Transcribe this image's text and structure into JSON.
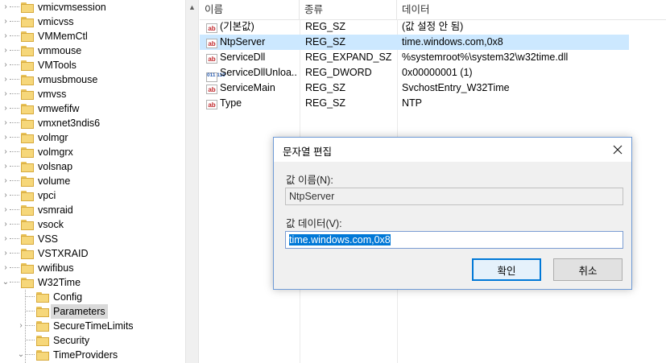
{
  "tree": {
    "items": [
      {
        "label": "vmicvmsession",
        "expander": ">"
      },
      {
        "label": "vmicvss",
        "expander": ">"
      },
      {
        "label": "VMMemCtl",
        "expander": ">"
      },
      {
        "label": "vmmouse",
        "expander": ">"
      },
      {
        "label": "VMTools",
        "expander": ">"
      },
      {
        "label": "vmusbmouse",
        "expander": ">"
      },
      {
        "label": "vmvss",
        "expander": ">"
      },
      {
        "label": "vmwefifw",
        "expander": ">"
      },
      {
        "label": "vmxnet3ndis6",
        "expander": ">"
      },
      {
        "label": "volmgr",
        "expander": ">"
      },
      {
        "label": "volmgrx",
        "expander": ">"
      },
      {
        "label": "volsnap",
        "expander": ">"
      },
      {
        "label": "volume",
        "expander": ">"
      },
      {
        "label": "vpci",
        "expander": ">"
      },
      {
        "label": "vsmraid",
        "expander": ">"
      },
      {
        "label": "vsock",
        "expander": ">"
      },
      {
        "label": "VSS",
        "expander": ">"
      },
      {
        "label": "VSTXRAID",
        "expander": ">"
      },
      {
        "label": "vwifibus",
        "expander": ">"
      },
      {
        "label": "W32Time",
        "expander": "v"
      }
    ],
    "children": [
      {
        "label": "Config",
        "expander": ""
      },
      {
        "label": "Parameters",
        "expander": "",
        "selected": true
      },
      {
        "label": "SecureTimeLimits",
        "expander": ">"
      },
      {
        "label": "Security",
        "expander": ""
      },
      {
        "label": "TimeProviders",
        "expander": "v"
      }
    ]
  },
  "list": {
    "columns": {
      "name": "이름",
      "type": "종류",
      "data": "데이터"
    },
    "rows": [
      {
        "icon": "ab",
        "name": "(기본값)",
        "type": "REG_SZ",
        "data": "(값 설정 안 됨)"
      },
      {
        "icon": "ab",
        "name": "NtpServer",
        "type": "REG_SZ",
        "data": "time.windows.com,0x8",
        "selected": true
      },
      {
        "icon": "ab",
        "name": "ServiceDll",
        "type": "REG_EXPAND_SZ",
        "data": "%systemroot%\\system32\\w32time.dll"
      },
      {
        "icon": "bin",
        "name": "ServiceDllUnloa...",
        "type": "REG_DWORD",
        "data": "0x00000001 (1)"
      },
      {
        "icon": "ab",
        "name": "ServiceMain",
        "type": "REG_SZ",
        "data": "SvchostEntry_W32Time"
      },
      {
        "icon": "ab",
        "name": "Type",
        "type": "REG_SZ",
        "data": "NTP"
      }
    ]
  },
  "dialog": {
    "title": "문자열 편집",
    "close_glyph": "✕",
    "name_label": "값 이름(N):",
    "name_value": "NtpServer",
    "data_label": "값 데이터(V):",
    "data_value": "time.windows.com,0x8",
    "ok_label": "확인",
    "cancel_label": "취소"
  },
  "icons": {
    "ab_text": "ab",
    "bin_text": "011 110"
  }
}
